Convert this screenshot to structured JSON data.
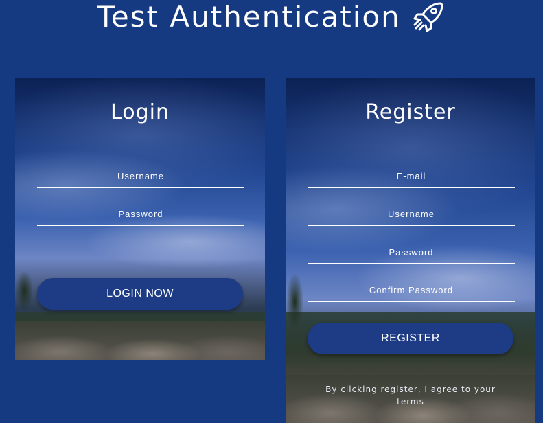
{
  "header": {
    "title": "Test Authentication",
    "icon": "rocket-icon"
  },
  "login": {
    "heading": "Login",
    "username_placeholder": "Username",
    "password_placeholder": "Password",
    "submit_label": "LOGIN NOW"
  },
  "register": {
    "heading": "Register",
    "email_placeholder": "E-mail",
    "username_placeholder": "Username",
    "password_placeholder": "Password",
    "confirm_password_placeholder": "Confirm Password",
    "submit_label": "REGISTER",
    "terms_text": "By clicking register, I agree to your terms"
  },
  "colors": {
    "background": "#163a82",
    "button": "#1e3c86",
    "text": "#ffffff"
  }
}
